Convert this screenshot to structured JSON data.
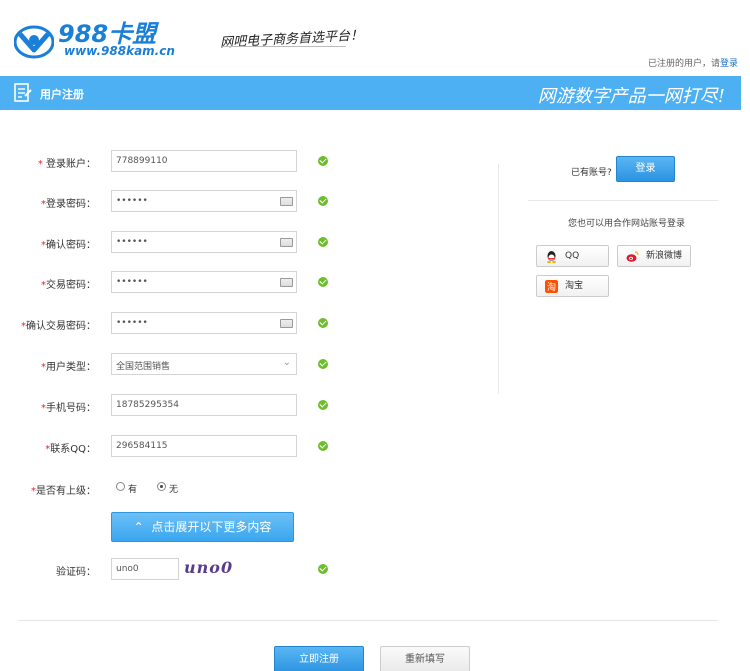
{
  "header": {
    "logo_text": "988卡盟",
    "logo_url": "www.988kam.cn",
    "slogan": "网吧电子商务首选平台！",
    "registered_prompt": "已注册的用户，请",
    "login_link": "登录"
  },
  "bar": {
    "title": "用户注册",
    "slogan": "网游数字产品一网打尽!"
  },
  "form": {
    "account": {
      "label": "登录账户：",
      "value": "778899110"
    },
    "password": {
      "label": "登录密码：",
      "value": "••••••"
    },
    "confirm_password": {
      "label": "确认密码：",
      "value": "••••••"
    },
    "trade_password": {
      "label": "交易密码：",
      "value": "••••••"
    },
    "confirm_trade_password": {
      "label": "确认交易密码：",
      "value": "••••••"
    },
    "user_type": {
      "label": "用户类型：",
      "value": "全国范围销售"
    },
    "phone": {
      "label": "手机号码：",
      "value": "18785295354"
    },
    "qq": {
      "label": "联系QQ：",
      "value": "296584115"
    },
    "superior": {
      "label": "是否有上级：",
      "option_yes": "有",
      "option_no": "无"
    },
    "expand_label": "点击展开以下更多内容",
    "captcha": {
      "label": "验证码：",
      "value": "uno0",
      "image_text": "uno0"
    },
    "submit_label": "立即注册",
    "reset_label": "重新填写"
  },
  "side": {
    "have_account": "已有账号?",
    "login_label": "登录",
    "partner_text": "您也可以用合作网站账号登录",
    "qq_label": "QQ",
    "weibo_label": "新浪微博",
    "taobao_label": "淘宝"
  },
  "colors": {
    "accent": "#4cb0f3",
    "required": "#e0262b",
    "ok": "#6cbf2c"
  }
}
